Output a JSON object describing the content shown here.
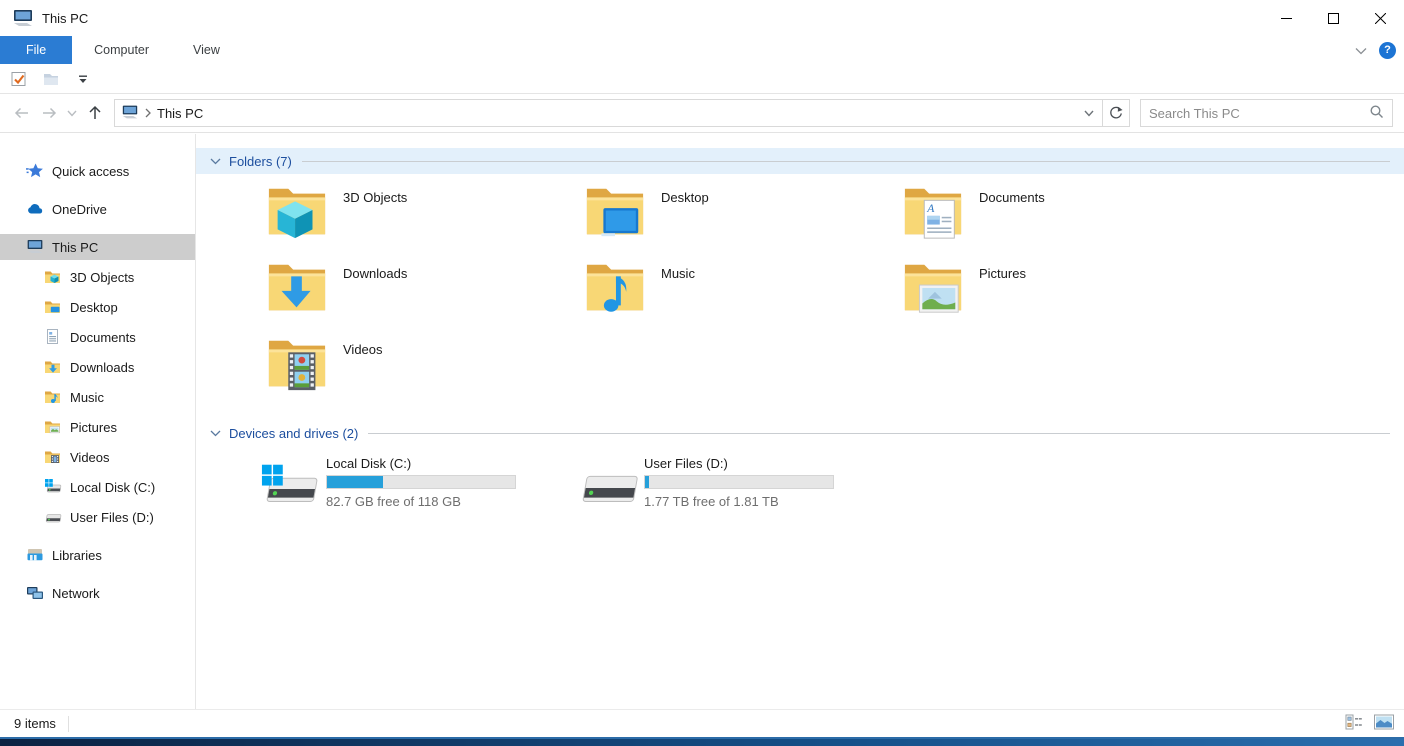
{
  "titlebar": {
    "title": "This PC"
  },
  "window_controls": {
    "icons": [
      "minimize-icon",
      "maximize-icon",
      "close-icon"
    ]
  },
  "ribbon": {
    "tabs": [
      {
        "label": "File",
        "active": true
      },
      {
        "label": "Computer",
        "active": false
      },
      {
        "label": "View",
        "active": false
      }
    ],
    "help_label": "?",
    "icons": [
      "collapse-ribbon-chevron-icon",
      "help-icon"
    ]
  },
  "qat": {
    "icons": [
      "properties-icon",
      "new-folder-icon",
      "customize-qat-icon"
    ]
  },
  "navbar": {
    "breadcrumb": "This PC",
    "search_placeholder": "Search This PC",
    "icons": [
      "back-icon",
      "forward-icon",
      "recent-locations-chevron-icon",
      "up-icon",
      "pc-icon",
      "breadcrumb-chevron-icon",
      "address-dropdown-chevron-icon",
      "refresh-icon",
      "search-icon"
    ]
  },
  "sidebar": {
    "items": [
      {
        "label": "Quick access",
        "icon": "quick-access-star"
      },
      {
        "label": "OneDrive",
        "icon": "onedrive-cloud"
      },
      {
        "label": "This PC",
        "icon": "pc-monitor",
        "selected": true
      },
      {
        "label": "3D Objects",
        "icon": "folder-3d-objects"
      },
      {
        "label": "Desktop",
        "icon": "folder-desktop"
      },
      {
        "label": "Documents",
        "icon": "documents-page"
      },
      {
        "label": "Downloads",
        "icon": "folder-downloads"
      },
      {
        "label": "Music",
        "icon": "folder-music"
      },
      {
        "label": "Pictures",
        "icon": "folder-pictures"
      },
      {
        "label": "Videos",
        "icon": "folder-videos"
      },
      {
        "label": "Local Disk (C:)",
        "icon": "drive-windows"
      },
      {
        "label": "User Files (D:)",
        "icon": "drive"
      },
      {
        "label": "Libraries",
        "icon": "libraries"
      },
      {
        "label": "Network",
        "icon": "network"
      }
    ]
  },
  "content": {
    "folders": {
      "header": "Folders (7)",
      "items": [
        "3D Objects",
        "Desktop",
        "Documents",
        "Downloads",
        "Music",
        "Pictures",
        "Videos"
      ]
    },
    "drives": {
      "header": "Devices and drives (2)",
      "items": [
        {
          "name": "Local Disk (C:)",
          "free": "82.7 GB free of 118 GB",
          "used_pct": 30
        },
        {
          "name": "User Files (D:)",
          "free": "1.77 TB free of 1.81 TB",
          "used_pct": 2
        }
      ]
    }
  },
  "statusbar": {
    "count": "9 items",
    "icons": [
      "details-view-icon",
      "thumbnails-view-icon"
    ]
  },
  "colors": {
    "accent_tab": "#2b7cd3",
    "drive_bar_fill": "#26a0da",
    "group_header_text": "#1c4e9e",
    "group_header_highlight": "#e3f0fb",
    "sidebar_selection": "#cdcdcd",
    "folder_yellow": "#f8d775"
  }
}
